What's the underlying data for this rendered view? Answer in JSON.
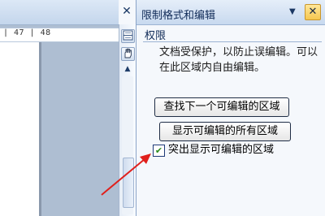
{
  "document": {
    "close_glyph": "✕",
    "ruler_text": "| 47 | 48"
  },
  "scrollbar": {
    "top_icon": "split-view-icon",
    "hand_icon": "hand-icon",
    "up_arrow": "▲"
  },
  "task_pane": {
    "title": "限制格式和编辑",
    "menu_glyph": "▼",
    "close_glyph": "✕",
    "section_title": "权限",
    "description": "文档受保护，以防止误编辑。可以在此区域内自由编辑。",
    "find_next_button": "查找下一个可编辑的区域",
    "show_all_button": "显示可编辑的所有区域",
    "highlight_checkbox": {
      "label": "突出显示可编辑的区域",
      "checked": true,
      "check_glyph": "✔"
    }
  },
  "colors": {
    "annotation_arrow": "#e0201c",
    "pane_background": "#f5f8fc",
    "pane_header": "#c8d9ef"
  }
}
